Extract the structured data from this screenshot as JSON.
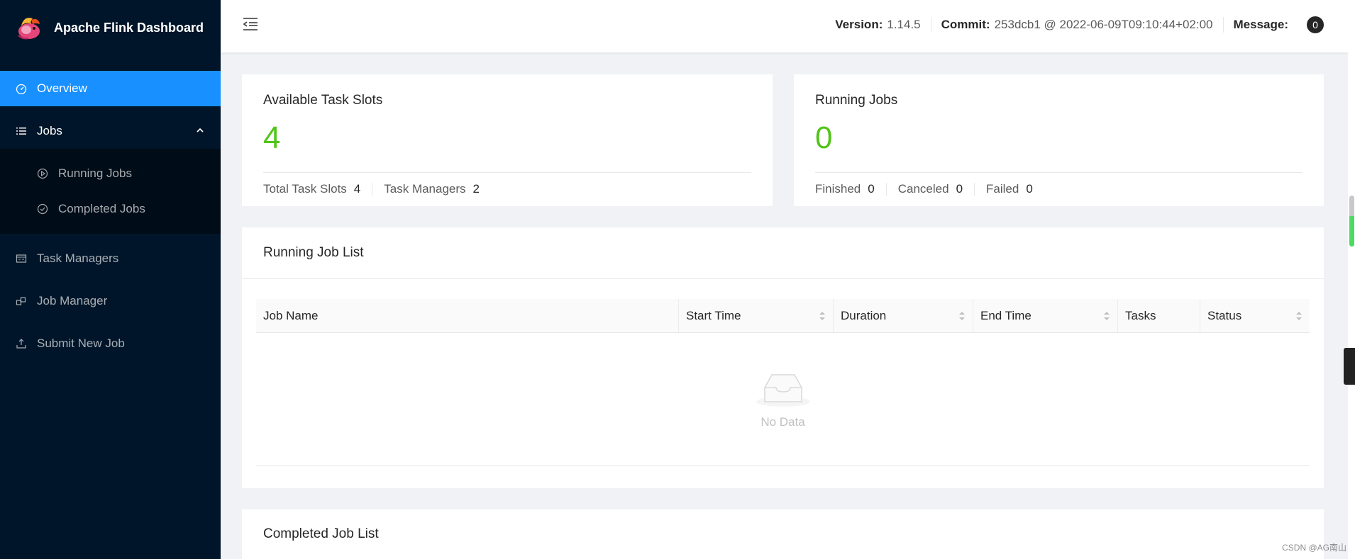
{
  "app": {
    "title": "Apache Flink Dashboard"
  },
  "sidebar": {
    "items": [
      {
        "label": "Overview",
        "icon": "dashboard-icon"
      },
      {
        "label": "Jobs",
        "icon": "list-icon"
      },
      {
        "label": "Running Jobs",
        "icon": "play-circle-icon"
      },
      {
        "label": "Completed Jobs",
        "icon": "check-circle-icon"
      },
      {
        "label": "Task Managers",
        "icon": "schedule-icon"
      },
      {
        "label": "Job Manager",
        "icon": "block-icon"
      },
      {
        "label": "Submit New Job",
        "icon": "upload-icon"
      }
    ]
  },
  "header": {
    "version_label": "Version:",
    "version_value": "1.14.5",
    "commit_label": "Commit:",
    "commit_value": "253dcb1 @ 2022-06-09T09:10:44+02:00",
    "message_label": "Message:",
    "message_count": "0"
  },
  "slots_card": {
    "title": "Available Task Slots",
    "value": "4",
    "total_label": "Total Task Slots",
    "total_value": "4",
    "tm_label": "Task Managers",
    "tm_value": "2"
  },
  "jobs_card": {
    "title": "Running Jobs",
    "value": "0",
    "finished_label": "Finished",
    "finished_value": "0",
    "canceled_label": "Canceled",
    "canceled_value": "0",
    "failed_label": "Failed",
    "failed_value": "0"
  },
  "running_list": {
    "title": "Running Job List",
    "columns": [
      "Job Name",
      "Start Time",
      "Duration",
      "End Time",
      "Tasks",
      "Status"
    ],
    "empty_text": "No Data"
  },
  "completed_list": {
    "title": "Completed Job List"
  },
  "watermark": "CSDN @AG南山",
  "colors": {
    "sidebar_bg": "#001529",
    "accent": "#1890ff",
    "stat_value": "#52c41a"
  }
}
